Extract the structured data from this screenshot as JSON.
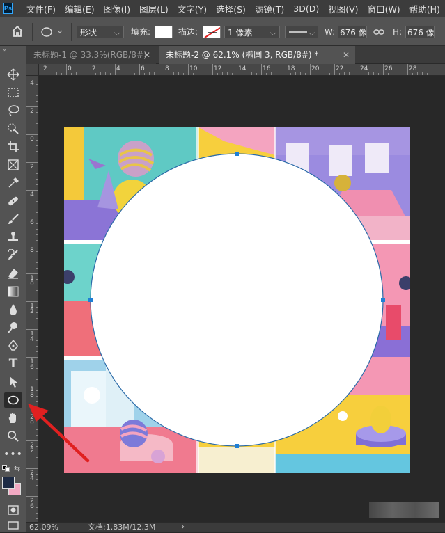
{
  "app": {
    "logo": "Ps"
  },
  "menu": [
    "文件(F)",
    "编辑(E)",
    "图像(I)",
    "图层(L)",
    "文字(Y)",
    "选择(S)",
    "滤镜(T)",
    "3D(D)",
    "视图(V)",
    "窗口(W)",
    "帮助(H)"
  ],
  "options": {
    "mode": "形状",
    "fill_label": "填充:",
    "stroke_label": "描边:",
    "stroke_size": "1 像素",
    "width_label": "W:",
    "width_value": "676 像",
    "height_label": "H:",
    "height_value": "676 像"
  },
  "tabs": [
    {
      "label": "未标题-1 @ 33.3%(RGB/8#)",
      "active": false
    },
    {
      "label": "未标题-2 @ 62.1% (椭圆 3, RGB/8#) *",
      "active": true
    }
  ],
  "ruler": {
    "h_labels": [
      "2",
      "0",
      "2",
      "4",
      "6",
      "8",
      "10",
      "12",
      "14",
      "16",
      "18",
      "20",
      "22",
      "24",
      "26",
      "28"
    ],
    "v_labels": [
      "4",
      "2",
      "0",
      "2",
      "4",
      "6",
      "8",
      "10",
      "12",
      "14",
      "16",
      "18",
      "20",
      "22",
      "24",
      "26",
      "28"
    ]
  },
  "status": {
    "zoom": "62.09%",
    "doc": "文档:1.83M/12.3M",
    "arrow": "›"
  },
  "colors": {
    "chrome_dark": "#3c3c3c",
    "panel": "#535353",
    "pasteboard": "#282828",
    "selection_blue": "#1e7fd6",
    "foreground_color": "#1d2a44",
    "background_color": "#f2a9c3",
    "annotation_arrow": "#e02020"
  },
  "annotation": {
    "type": "arrow",
    "points_to": "ellipse-tool"
  }
}
